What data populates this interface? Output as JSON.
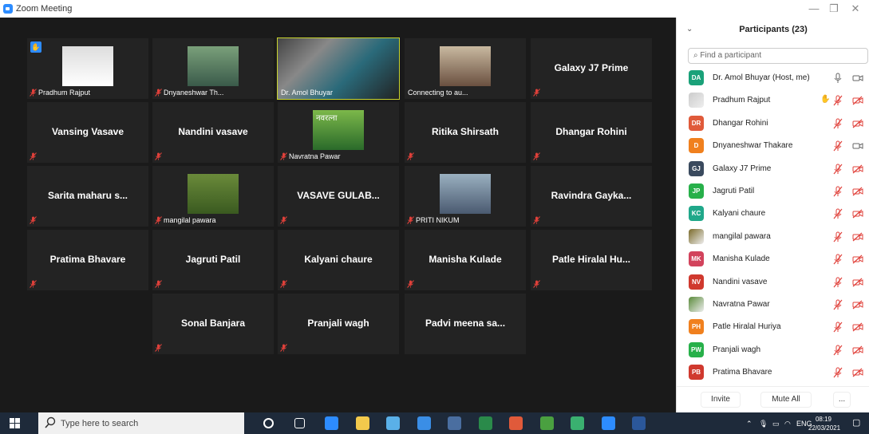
{
  "window": {
    "title": "Zoom Meeting",
    "controls": [
      "—",
      "❐",
      "✕"
    ]
  },
  "gallery": {
    "tiles": [
      {
        "name": "Pradhum Rajput",
        "label_style": "small",
        "has_video": true,
        "hand_raised": true,
        "muted": true
      },
      {
        "name": "Dnyaneshwar Th...",
        "label_style": "small",
        "has_video": true,
        "muted": true
      },
      {
        "name": "Dr. Amol Bhuyar",
        "label_style": "small",
        "has_video": true,
        "active_speaker": true,
        "muted": false
      },
      {
        "name": "Connecting to au...",
        "label_style": "small",
        "has_video": true,
        "muted": false
      },
      {
        "name": "Galaxy J7 Prime",
        "label_style": "big",
        "muted": true
      },
      {
        "name": "Vansing Vasave",
        "label_style": "big",
        "muted": true
      },
      {
        "name": "Nandini vasave",
        "label_style": "big",
        "muted": true
      },
      {
        "name": "Navratna Pawar",
        "label_style": "small",
        "has_video": true,
        "image_text": "नवरत्ना",
        "muted": true
      },
      {
        "name": "Ritika Shirsath",
        "label_style": "big",
        "muted": true
      },
      {
        "name": "Dhangar Rohini",
        "label_style": "big",
        "muted": true
      },
      {
        "name": "Sarita maharu s...",
        "label_style": "big",
        "muted": true
      },
      {
        "name": "mangilal pawara",
        "label_style": "small",
        "has_video": true,
        "muted": true
      },
      {
        "name": "VASAVE GULAB...",
        "label_style": "big",
        "muted": true
      },
      {
        "name": "PRITI NIKUM",
        "label_style": "small",
        "has_video": true,
        "muted": true
      },
      {
        "name": "Ravindra Gayka...",
        "label_style": "big",
        "muted": true
      },
      {
        "name": "Pratima Bhavare",
        "label_style": "big",
        "muted": true
      },
      {
        "name": "Jagruti Patil",
        "label_style": "big",
        "muted": true
      },
      {
        "name": "Kalyani chaure",
        "label_style": "big",
        "muted": true
      },
      {
        "name": "Manisha Kulade",
        "label_style": "big",
        "muted": true
      },
      {
        "name": "Patle Hiralal Hu...",
        "label_style": "big",
        "muted": true
      },
      {
        "name": "Sonal Banjara",
        "label_style": "big",
        "muted": true
      },
      {
        "name": "Pranjali wagh",
        "label_style": "big",
        "muted": true
      },
      {
        "name": "Padvi meena sa...",
        "label_style": "big",
        "muted": false
      }
    ]
  },
  "participants": {
    "title": "Participants (23)",
    "search_placeholder": "Find a participant",
    "list": [
      {
        "initials": "DA",
        "name": "Dr. Amol Bhuyar (Host, me)",
        "color": "#1aa179",
        "mic": "on",
        "video": "on"
      },
      {
        "initials": "",
        "name": "Pradhum Rajput",
        "color": "#cccccc",
        "photo": true,
        "hand": true,
        "mic": "muted",
        "video": "off"
      },
      {
        "initials": "DR",
        "name": "Dhangar Rohini",
        "color": "#e05a3a",
        "mic": "muted",
        "video": "off"
      },
      {
        "initials": "D",
        "name": "Dnyaneshwar Thakare",
        "color": "#f0801e",
        "mic": "muted",
        "video": "on"
      },
      {
        "initials": "GJ",
        "name": "Galaxy J7 Prime",
        "color": "#3a4a5e",
        "mic": "muted",
        "video": "off"
      },
      {
        "initials": "JP",
        "name": "Jagruti Patil",
        "color": "#27b04a",
        "mic": "muted",
        "video": "off"
      },
      {
        "initials": "KC",
        "name": "Kalyani chaure",
        "color": "#20a88a",
        "mic": "muted",
        "video": "off"
      },
      {
        "initials": "",
        "name": "mangilal pawara",
        "color": "#7a6a2a",
        "photo": true,
        "mic": "muted",
        "video": "off"
      },
      {
        "initials": "MK",
        "name": "Manisha Kulade",
        "color": "#d2435c",
        "mic": "muted",
        "video": "off"
      },
      {
        "initials": "NV",
        "name": "Nandini vasave",
        "color": "#d0392e",
        "mic": "muted",
        "video": "off"
      },
      {
        "initials": "",
        "name": "Navratna Pawar",
        "color": "#5a8a3a",
        "photo": true,
        "mic": "muted",
        "video": "off"
      },
      {
        "initials": "PH",
        "name": "Patle Hiralal Huriya",
        "color": "#f0801e",
        "mic": "muted",
        "video": "off"
      },
      {
        "initials": "PW",
        "name": "Pranjali wagh",
        "color": "#27b04a",
        "mic": "muted",
        "video": "off"
      },
      {
        "initials": "PB",
        "name": "Pratima Bhavare",
        "color": "#d0392e",
        "mic": "muted",
        "video": "off"
      }
    ],
    "footer": {
      "invite": "Invite",
      "mute_all": "Mute All",
      "more": "..."
    }
  },
  "taskbar": {
    "search_placeholder": "Type here to search",
    "apps": [
      "cortana",
      "task-view",
      "edge",
      "file-explorer",
      "store",
      "mail",
      "calculator",
      "excel",
      "paint",
      "powerpoint",
      "browser",
      "zoom",
      "word"
    ],
    "tray": {
      "language": "ENG",
      "time": "08:19",
      "date": "22/03/2021"
    }
  },
  "colors": {
    "accent": "#2d8cff",
    "active_speaker": "#c8d42d",
    "mute_red": "#e0403a"
  }
}
